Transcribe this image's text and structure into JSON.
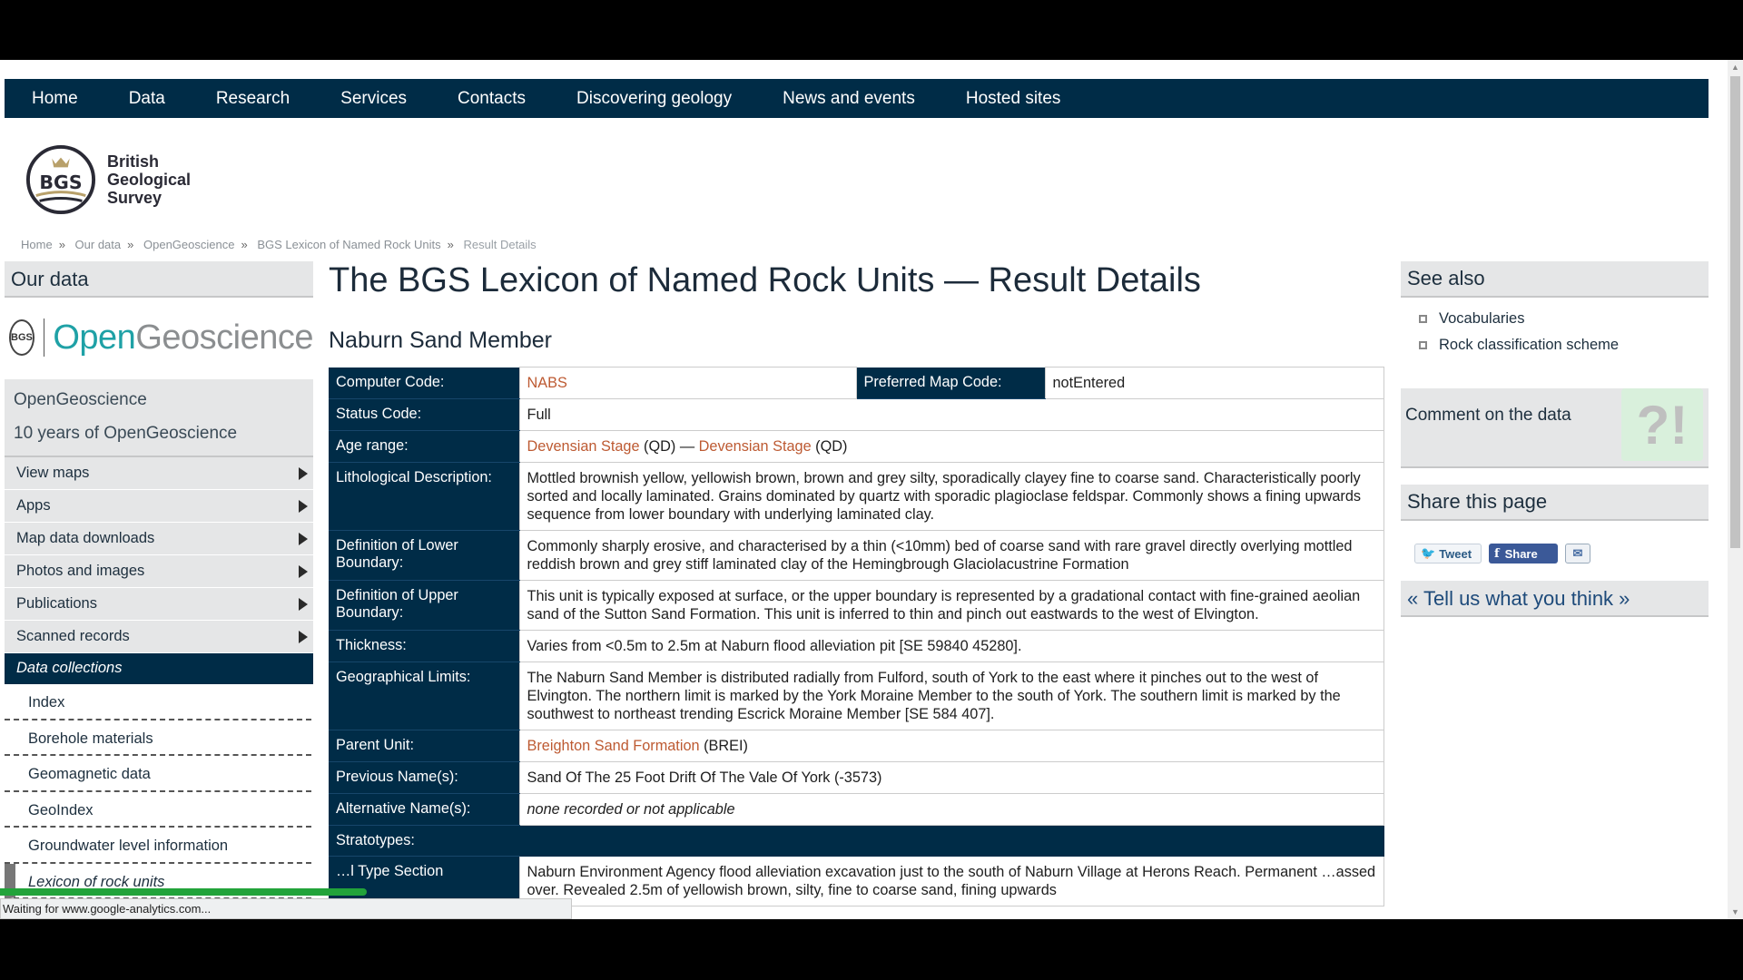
{
  "nav": [
    "Home",
    "Data",
    "Research",
    "Services",
    "Contacts",
    "Discovering geology",
    "News and events",
    "Hosted sites"
  ],
  "logo": {
    "line1": "British",
    "line2": "Geological",
    "line3": "Survey",
    "mark": "BGS"
  },
  "breadcrumb": [
    "Home",
    "Our data",
    "OpenGeoscience",
    "BGS Lexicon of Named Rock Units",
    "Result Details"
  ],
  "left": {
    "heading": "Our data",
    "og_logo": {
      "bgs": "BGS",
      "open": "Open",
      "geoscience": "Geoscience"
    },
    "og_links": [
      "OpenGeoscience",
      "10 years of OpenGeoscience"
    ],
    "menu": [
      "View maps",
      "Apps",
      "Map data downloads",
      "Photos and images",
      "Publications",
      "Scanned records"
    ],
    "data_collections": "Data collections",
    "sub": [
      "Index",
      "Borehole materials",
      "Geomagnetic data",
      "GeoIndex",
      "Groundwater level information",
      "Lexicon of rock units"
    ]
  },
  "main": {
    "title": "The BGS Lexicon of Named Rock Units — Result Details",
    "unit_name": "Naburn Sand Member",
    "rows": {
      "computer_code_label": "Computer Code:",
      "computer_code": "NABS",
      "map_code_label": "Preferred Map Code:",
      "map_code": "notEntered",
      "status_label": "Status Code:",
      "status": "Full",
      "age_label": "Age range:",
      "age_from": "Devensian Stage",
      "age_from_code": " (QD) — ",
      "age_to": "Devensian Stage",
      "age_to_code": " (QD)",
      "litho_label": "Lithological Description:",
      "litho": "Mottled brownish yellow, yellowish brown, brown and grey silty, sporadically clayey fine to coarse sand. Characteristically poorly sorted and locally laminated. Grains dominated by quartz with sporadic plagioclase feldspar. Commonly shows a fining upwards sequence from lower boundary with underlying laminated clay.",
      "lower_label": "Definition of Lower Boundary:",
      "lower": "Commonly sharply erosive, and characterised by a thin (<10mm) bed of coarse sand with rare gravel directly overlying mottled reddish brown and grey stiff laminated clay of the Hemingbrough Glaciolacustrine Formation",
      "upper_label": "Definition of Upper Boundary:",
      "upper": "This unit is typically exposed at surface, or the upper boundary is represented by a gradational contact with fine-grained aeolian sand of the Sutton Sand Formation. This unit is inferred to thin and pinch out eastwards to the west of Elvington.",
      "thickness_label": "Thickness:",
      "thickness": "Varies from <0.5m to 2.5m at Naburn flood alleviation pit [SE 59840 45280].",
      "geo_label": "Geographical Limits:",
      "geo": "The Naburn Sand Member is distributed radially from Fulford, south of York to the east where it pinches out to the west of Elvington. The northern limit is marked by the York Moraine Member to the south of York. The southern limit is marked by the southwest to northeast trending Escrick Moraine Member [SE 584 407].",
      "parent_label": "Parent Unit:",
      "parent": "Breighton Sand Formation",
      "parent_code": " (BREI)",
      "prev_label": "Previous Name(s):",
      "prev": "Sand Of The 25 Foot Drift Of The Vale Of York (-3573)",
      "alt_label": "Alternative Name(s):",
      "alt": "none recorded or not applicable",
      "strato_label": "Stratotypes:",
      "type_label": "…l Type Section",
      "type_text": "Naburn Environment Agency flood alleviation excavation just to the south of Naburn Village at Herons Reach. Permanent …assed over. Revealed 2.5m of yellowish brown, silty, fine to coarse sand, fining upwards"
    }
  },
  "right": {
    "see_also": "See also",
    "links": [
      "Vocabularies",
      "Rock classification scheme"
    ],
    "comment": "Comment on the data",
    "share": "Share this page",
    "tweet": "Tweet",
    "fb": "Share",
    "tell_us": "« Tell us what you think »"
  },
  "status": "Waiting for www.google-analytics.com..."
}
